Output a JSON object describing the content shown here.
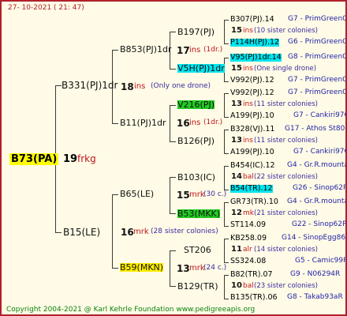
{
  "date": "27- 10-2021 ( 21: 47)",
  "root": {
    "label": "B73(PA)",
    "gen": "19",
    "code": "frkg"
  },
  "gen1_upper": {
    "label": "B331(PJ)1dr",
    "gen": "18",
    "code": "ins",
    "note": "(Only one drone)"
  },
  "gen1_lower": {
    "label": "B15(LE)",
    "gen": "16",
    "code": "mrk",
    "note": "(28 sister colonies)"
  },
  "g2a": {
    "label": "B853(PJ)1dr",
    "gen": "17",
    "code": "ins",
    "note": "(1dr.)"
  },
  "g2b": {
    "label": "B11(PJ)1dr",
    "gen": "16",
    "code": "ins",
    "note": "(1dr.)"
  },
  "g2c": {
    "label": "B65(LE)",
    "gen": "15",
    "code": "mrk",
    "note": "(30 c.)"
  },
  "g2d": {
    "label": "B59(MKN)",
    "gen": "13",
    "code": "mrk",
    "note": "(24 c.)"
  },
  "g3": [
    {
      "label": "B197(PJ)"
    },
    {
      "label": "V5H(PJ)1dr"
    },
    {
      "label": "V216(PJ)"
    },
    {
      "label": "B126(PJ)"
    },
    {
      "label": "B103(IC)"
    },
    {
      "label": "B53(MKK)"
    },
    {
      "label": "ST206"
    },
    {
      "label": "B129(TR)"
    }
  ],
  "g4": [
    {
      "label": "B307(PJ).14",
      "right": "G7 - PrimGreen00"
    },
    {
      "gen": "15",
      "code": "ins",
      "note": "(10 sister colonies)"
    },
    {
      "label": "P114H(PJ).12",
      "right": "G6 - PrimGreen00"
    },
    {
      "label": "V95(PJ)1dr.14",
      "right": "G8 - PrimGreen00"
    },
    {
      "gen": "15",
      "code": "ins",
      "note": "(One single drone)"
    },
    {
      "label": "V992(PJ).12",
      "right": "G7 - PrimGreen00"
    },
    {
      "label": "V992(PJ).12",
      "right": "G7 - PrimGreen00"
    },
    {
      "gen": "13",
      "code": "ins",
      "note": "(11 sister colonies)"
    },
    {
      "label": "A199(PJ).10",
      "right": "G7 - Cankiri97Q"
    },
    {
      "label": "B328(VJ).11",
      "right": "G17 - Athos St80R"
    },
    {
      "gen": "13",
      "code": "ins",
      "note": "(11 sister colonies)"
    },
    {
      "label": "A199(PJ).10",
      "right": "G7 - Cankiri97Q"
    },
    {
      "label": "B454(IC).12",
      "right": "G4 - Gr.R.mounta"
    },
    {
      "gen": "14",
      "code": "bal",
      "note": "(22 sister colonies)"
    },
    {
      "label": "B54(TR).12",
      "right": "G26 - Sinop62R"
    },
    {
      "label": "GR73(TR).10",
      "right": "G4 - Gr.R.mounta"
    },
    {
      "gen": "12",
      "code": "mk",
      "note": "(21 sister colonies)"
    },
    {
      "label": "ST114.09",
      "right": "G22 - Sinop62R"
    },
    {
      "label": "KB258.09",
      "right": "G14 - SinopEgg86R"
    },
    {
      "gen": "11",
      "code": "alr",
      "note": "(14 sister colonies)"
    },
    {
      "label": "SS324.08",
      "right": "G5 - Camic99R"
    },
    {
      "label": "B82(TR).07",
      "right": "G9 - N06294R"
    },
    {
      "gen": "10",
      "code": "bal",
      "note": "(23 sister colonies)"
    },
    {
      "label": "B135(TR).06",
      "right": "G8 - Takab93aR"
    }
  ],
  "footer": "Copyright 2004-2021 @ Karl Kehrle Foundation   www.pedigreeapis.org",
  "colors": {
    "border": "#b0202a",
    "background": "#fffbe6",
    "accent_red": "#c0141c",
    "right_blue": "#2222aa",
    "footer_green": "#108010",
    "highlight_cyan": "#00e5ee",
    "highlight_green": "#22cc22",
    "highlight_yellow": "#ffee00"
  }
}
